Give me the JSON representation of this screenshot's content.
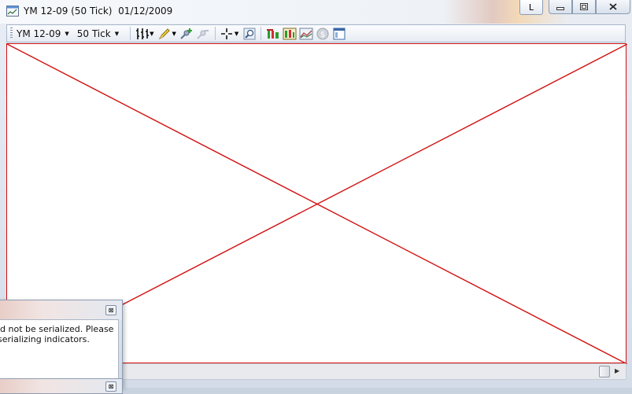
{
  "window": {
    "title": "YM 12-09 (50 Tick)  01/12/2009",
    "caption_l": "L",
    "caption_minimize": "▭",
    "caption_restore": "▣",
    "caption_close": "✕"
  },
  "toolbar": {
    "instrument": "YM 12-09",
    "interval": "50 Tick",
    "icons": [
      "bar-style-icon",
      "pencil-icon",
      "add-indicator-icon",
      "remove-indicator-icon",
      "crosshair-icon",
      "zoom-icon",
      "strategy-icon",
      "market-replay-icon",
      "chart-trader-icon",
      "currency-icon",
      "properties-icon"
    ]
  },
  "colors": {
    "error_red": "#d21010"
  },
  "dialog": {
    "message_line1": "ld not be serialized. Please",
    "message_line2": "serializing indicators.",
    "close_symbol": "⊠"
  },
  "dialog2": {
    "close_symbol": "⊠"
  }
}
